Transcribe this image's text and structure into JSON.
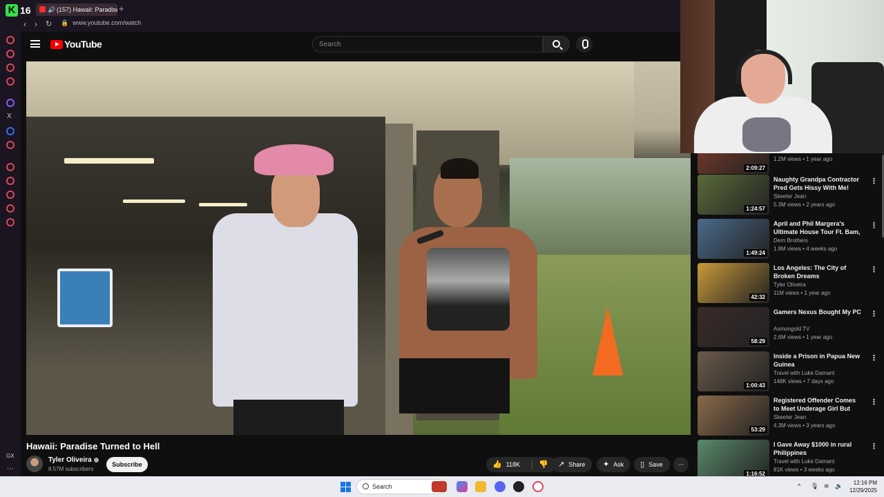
{
  "browser": {
    "logo": "K",
    "count": "16",
    "tab_title": "(157) Hawaii: Paradise",
    "address": "www.youtube.com/watch",
    "sidebar_bottom_label": "GX"
  },
  "youtube": {
    "logo_text": "YouTube",
    "search_placeholder": "Search"
  },
  "video": {
    "title": "Hawaii: Paradise Turned to Hell",
    "channel": "Tyler Oliveira",
    "subscribers": "8.57M subscribers",
    "subscribe_label": "Subscribe",
    "likes": "118K",
    "share_label": "Share",
    "ask_label": "Ask",
    "save_label": "Save"
  },
  "recommendations": [
    {
      "title": "",
      "channel": "",
      "meta": "1.2M views • 1 year ago",
      "duration": "2:09:27",
      "thumb_color": "#7a3a2a"
    },
    {
      "title": "Naughty Grandpa Contractor Pred Gets Hissy With Me!",
      "channel": "Skeeter Jean",
      "meta": "5.3M views • 2 years ago",
      "duration": "1:24:57",
      "thumb_color": "#5a6a3a"
    },
    {
      "title": "April and Phil Margera's Ultimate House Tour Ft. Bam, ...",
      "channel": "Dern Brothers",
      "meta": "1.8M views • 4 weeks ago",
      "duration": "1:49:24",
      "thumb_color": "#4a6a8a"
    },
    {
      "title": "Los Angeles: The City of Broken Dreams",
      "channel": "Tyler Oliveira",
      "meta": "11M views • 1 year ago",
      "duration": "42:32",
      "thumb_color": "#c89a3a"
    },
    {
      "title": "Gamers Nexus Bought My PC",
      "channel": "Asmongold TV",
      "meta": "2.6M views • 1 year ago",
      "duration": "58:29",
      "thumb_color": "#3a2a2a"
    },
    {
      "title": "Inside a Prison in Papua New Guinea",
      "channel": "Travel with Luke Damant",
      "meta": "148K views • 7 days ago",
      "duration": "1:00:43",
      "thumb_color": "#6a5a4a"
    },
    {
      "title": "Registered Offender Comes to Meet Underage Girl But Meets ...",
      "channel": "Skeeter Jean",
      "meta": "4.3M views • 3 years ago",
      "duration": "53:29",
      "thumb_color": "#8a6a4a"
    },
    {
      "title": "I Gave Away $1000 in rural Philippines",
      "channel": "Travel with Luke Damant",
      "meta": "81K views • 3 weeks ago",
      "duration": "1:16:52",
      "thumb_color": "#5a8a6a"
    }
  ],
  "taskbar": {
    "search_label": "Search",
    "time": "12:16 PM",
    "date": "12/29/2025"
  }
}
